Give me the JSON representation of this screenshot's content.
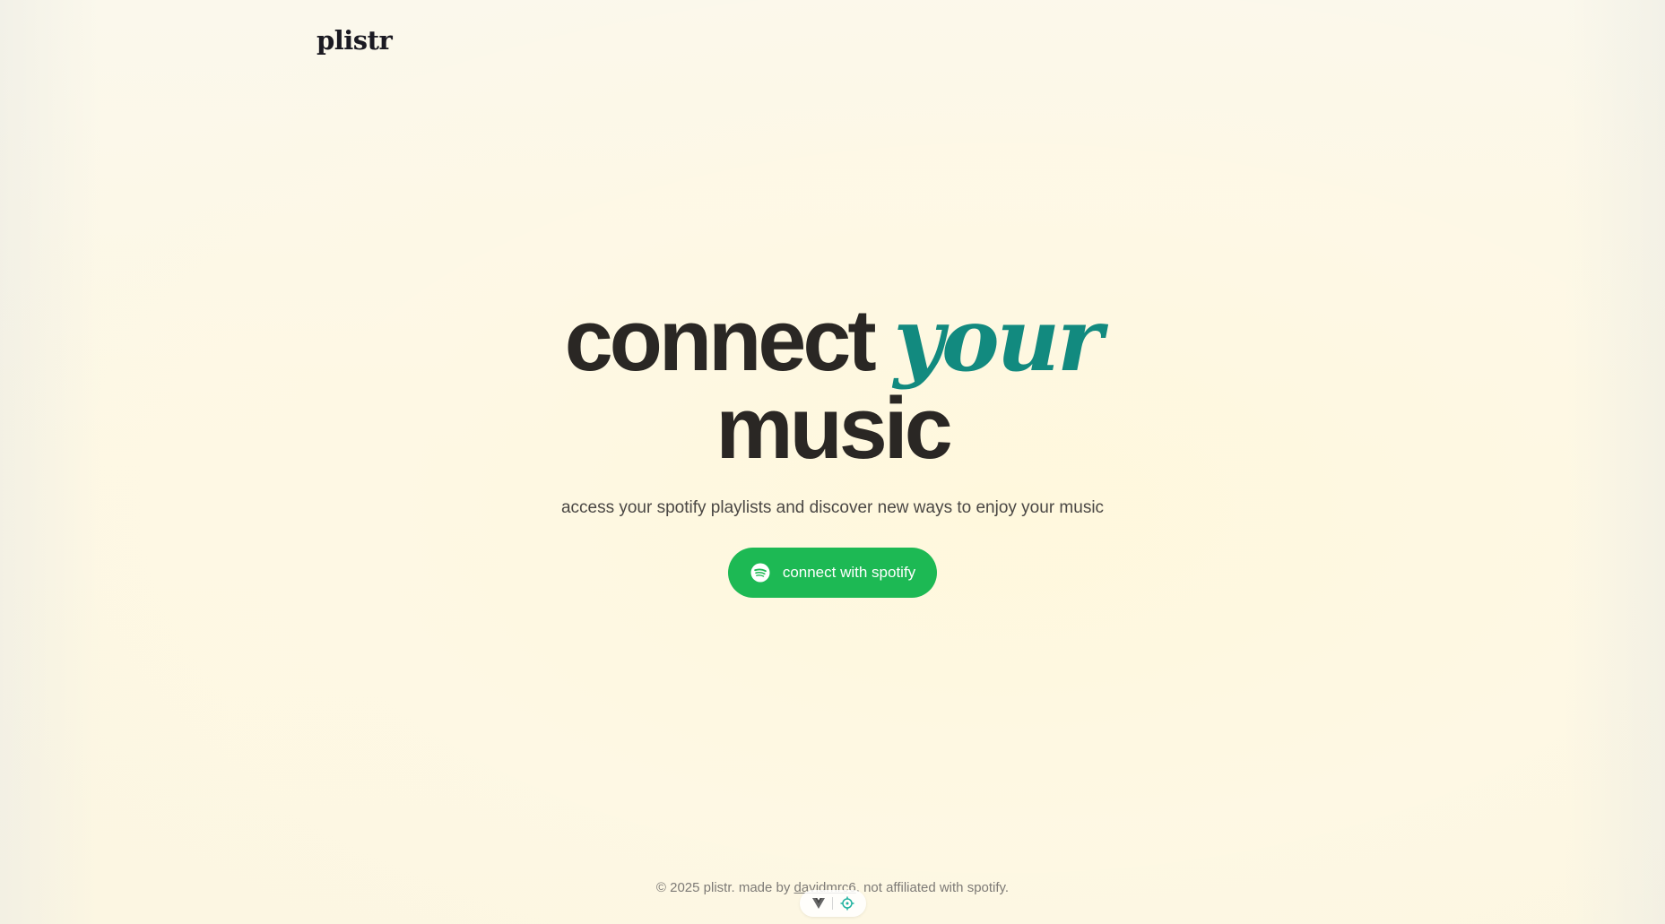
{
  "header": {
    "logo_text": "plistr"
  },
  "hero": {
    "headline_part1": "connect",
    "headline_accent": "your",
    "headline_part2": "music",
    "subtitle": "access your spotify playlists and discover new ways to enjoy your music",
    "cta_label": "connect with spotify"
  },
  "footer": {
    "prefix": "© 2025 plistr. made by",
    "author_link": "davidmrc6",
    "suffix": ". not affiliated with spotify."
  },
  "devtools": {
    "icons": [
      "vue-logo-icon",
      "inspector-target-icon"
    ]
  },
  "colors": {
    "accent": "#128a7f",
    "spotify_green": "#1db954",
    "text_dark": "#2a2724",
    "background": "#fcf7e4"
  }
}
